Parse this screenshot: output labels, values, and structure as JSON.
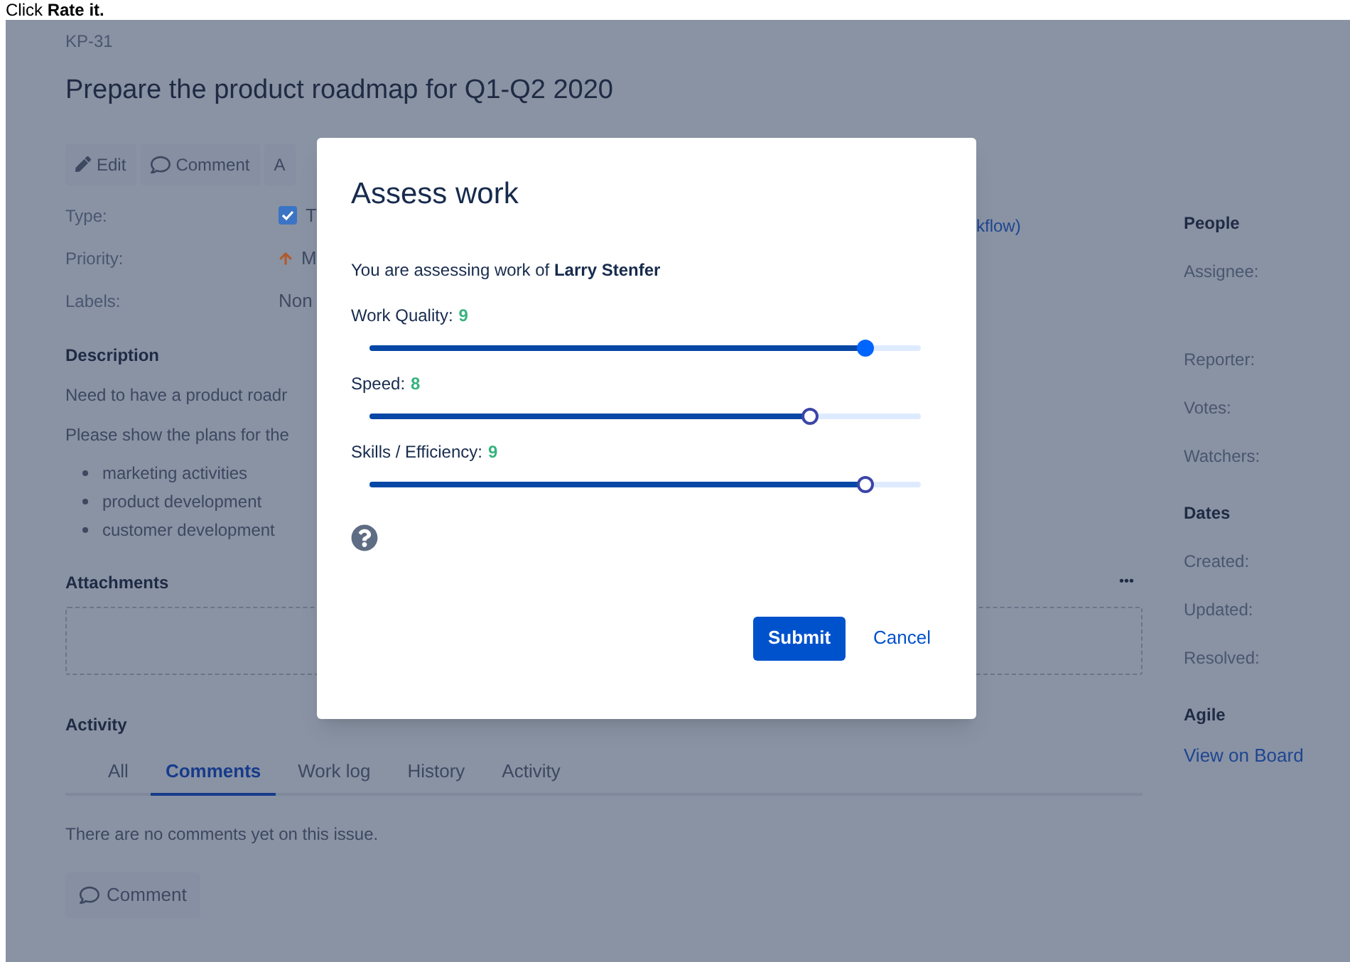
{
  "instruction": "Click **Rate it.**",
  "issue": {
    "key": "KP-31",
    "title": "Prepare the product roadmap for Q1-Q2 2020"
  },
  "toolbar": [
    {
      "kind": "edit",
      "label": "Edit"
    },
    {
      "kind": "comment",
      "label": "Comment"
    },
    {
      "kind": "text",
      "label": "A"
    }
  ],
  "fields": [
    {
      "kind": "type",
      "label": "Type:",
      "value": "T"
    },
    {
      "kind": "priority",
      "label": "Priority:",
      "value": "M"
    },
    {
      "kind": "plain",
      "label": "Labels:",
      "value": "Non"
    }
  ],
  "workflow_link": "kflow)",
  "description": {
    "heading": "Description",
    "paragraphs": [
      "Need to have a product roadr",
      "Please show the plans for the"
    ],
    "bullets": [
      "marketing activities",
      "product development",
      "customer development"
    ]
  },
  "attachments": {
    "heading": "Attachments",
    "menu": "•••"
  },
  "activity": {
    "heading": "Activity",
    "tabs": [
      {
        "label": "All",
        "selected": false
      },
      {
        "label": "Comments",
        "selected": true
      },
      {
        "label": "Work log",
        "selected": false
      },
      {
        "label": "History",
        "selected": false
      },
      {
        "label": "Activity",
        "selected": false
      }
    ],
    "empty": "There are no comments yet on this issue.",
    "button": "Comment"
  },
  "sidebar": [
    {
      "heading": "People",
      "items": [
        "Assignee:",
        "Reporter:",
        "Votes:",
        "Watchers:"
      ]
    },
    {
      "heading": "Dates",
      "items": [
        "Created:",
        "Updated:",
        "Resolved:"
      ]
    },
    {
      "heading": "Agile",
      "links": [
        "View on Board"
      ]
    }
  ],
  "dialog": {
    "title": "Assess work",
    "intro": "You are assessing work of **Larry Stenfer**",
    "sliders": [
      {
        "label": "Work Quality:",
        "reading": "9",
        "level": 0.9,
        "focused": true
      },
      {
        "label": "Speed:",
        "reading": "8",
        "level": 0.8,
        "focused": false
      },
      {
        "label": "Skills / Efficiency:",
        "reading": "9",
        "level": 0.9,
        "focused": false
      }
    ],
    "submit": "Submit",
    "cancel": "Cancel"
  }
}
